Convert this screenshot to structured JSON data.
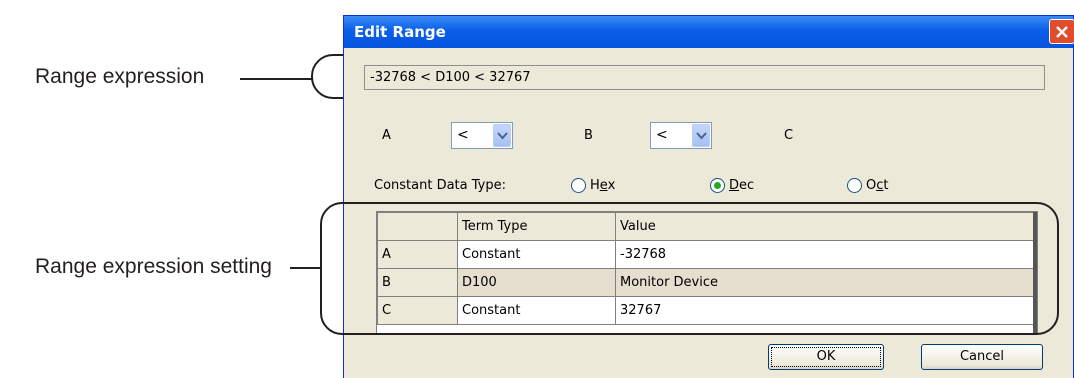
{
  "callouts": {
    "range_expression": "Range expression",
    "range_expression_setting": "Range expression setting"
  },
  "dialog": {
    "title": "Edit Range",
    "expression": "-32768 < D100 < 32767",
    "labels": {
      "a": "A",
      "b": "B",
      "c": "C"
    },
    "combo_a": "<",
    "combo_b": "<",
    "constant_data_type_label": "Constant Data Type:",
    "radios": [
      {
        "prefix": "H",
        "underline": "e",
        "suffix": "x",
        "selected": false
      },
      {
        "prefix": "",
        "underline": "D",
        "suffix": "ec",
        "selected": true
      },
      {
        "prefix": "O",
        "underline": "c",
        "suffix": "t",
        "selected": false
      }
    ],
    "table": {
      "headers": [
        "",
        "Term Type",
        "Value"
      ],
      "rows": [
        {
          "key": "A",
          "term_type": "Constant",
          "value": "-32768"
        },
        {
          "key": "B",
          "term_type": "D100",
          "value": "Monitor Device"
        },
        {
          "key": "C",
          "term_type": "Constant",
          "value": "32767"
        }
      ]
    },
    "ok_label": "OK",
    "cancel_label": "Cancel"
  },
  "colors": {
    "titlebar": "#0a5fe8",
    "dialog_bg": "#ece9d8",
    "close": "#e04d2d",
    "radio_selected": "#26a626"
  },
  "icons": {
    "close": "close-icon",
    "dropdown": "chevron-down-icon"
  }
}
